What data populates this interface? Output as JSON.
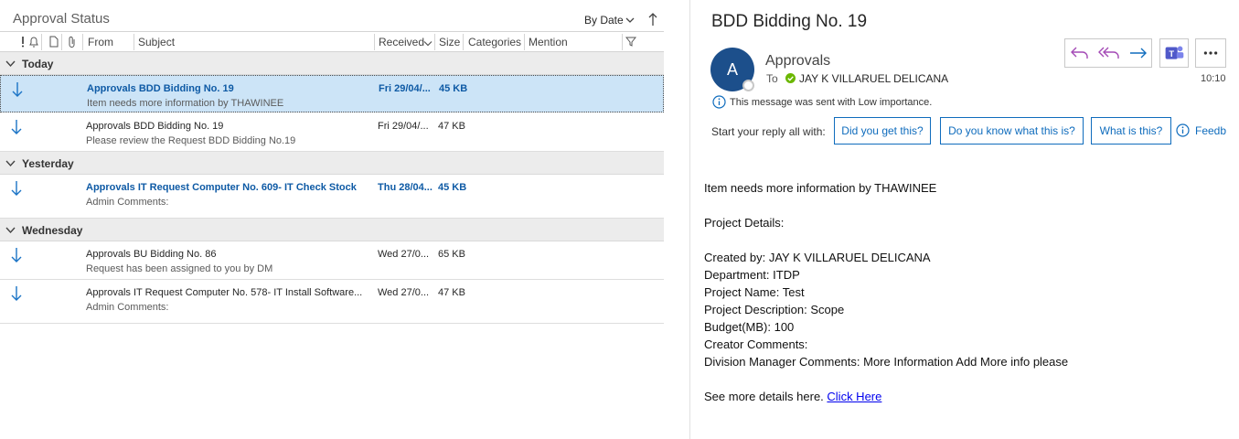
{
  "list": {
    "folder_title": "Approval Status",
    "sort_label": "By Date",
    "columns": {
      "from": "From",
      "subject": "Subject",
      "received": "Received",
      "size": "Size",
      "categories": "Categories",
      "mention": "Mention"
    },
    "groups": [
      {
        "label": "Today"
      },
      {
        "label": "Yesterday"
      },
      {
        "label": "Wednesday"
      }
    ],
    "rows": [
      {
        "sender_subject": "Approvals  BDD Bidding No. 19",
        "preview": "Item needs more information by THAWINEE",
        "received": "Fri 29/04/...",
        "size": "45 KB"
      },
      {
        "sender_subject": "Approvals  BDD Bidding No. 19",
        "preview": "Please review the Request BDD Bidding No.19",
        "received": "Fri 29/04/...",
        "size": "47 KB"
      },
      {
        "sender_subject": "Approvals  IT Request Computer No. 609- IT Check Stock",
        "preview": "Admin Comments:",
        "received": "Thu 28/04...",
        "size": "45 KB"
      },
      {
        "sender_subject": "Approvals  BU Bidding No. 86",
        "preview": "Request has been assigned to you by DM",
        "received": "Wed 27/0...",
        "size": "65 KB"
      },
      {
        "sender_subject": "Approvals  IT Request Computer No. 578- IT Install Software...",
        "preview": "Admin Comments:",
        "received": "Wed 27/0...",
        "size": "47 KB"
      }
    ]
  },
  "message": {
    "subject": "BDD Bidding No. 19",
    "avatar_initial": "A",
    "from": "Approvals",
    "to_label": "To",
    "to_name": "JAY K VILLARUEL DELICANA",
    "time": "10:10",
    "importance": "This message was sent with Low importance.",
    "suggest_label": "Start your reply all with:",
    "suggestions": [
      "Did you get this?",
      "Do you know what this is?",
      "What is this?"
    ],
    "feedback": "Feedb",
    "body": {
      "line1": "Item needs more information by THAWINEE",
      "line2": "Project Details:",
      "line3": "Created by: JAY K VILLARUEL DELICANA",
      "line4": "Department: ITDP",
      "line5": "Project Name: Test",
      "line6": "Project Description: Scope",
      "line7": "Budget(MB): 100",
      "line8": "Creator Comments:",
      "line9": "Division Manager Comments: More Information Add More info please",
      "see_more": "See more details here. ",
      "link_text": "Click Here"
    }
  },
  "colors": {
    "accent": "#0f6cbd",
    "unread_text": "#0e5aa5",
    "selected_row": "#cce4f7",
    "avatar": "#1c4f8b",
    "reply_purple": "#a44ab5",
    "teams_purple": "#5059c9"
  },
  "icons": [
    "importance-icon",
    "reminder-bell-icon",
    "item-type-icon",
    "attachment-icon",
    "filter-icon",
    "down-arrow-icon",
    "reply-icon",
    "reply-all-icon",
    "forward-icon",
    "teams-icon",
    "more-icon",
    "info-icon",
    "check-icon"
  ]
}
